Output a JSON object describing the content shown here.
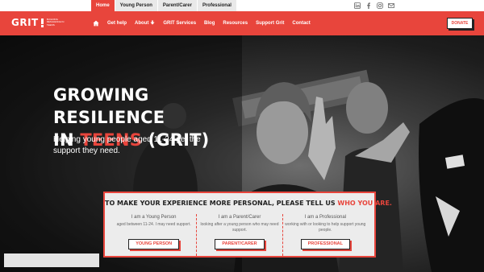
{
  "topbar": {
    "tabs": [
      "Home",
      "Young Person",
      "Parent/Carer",
      "Professional"
    ],
    "active_tab": "Home",
    "social_icons": [
      "linkedin-icon",
      "facebook-icon",
      "instagram-icon",
      "email-icon"
    ]
  },
  "brand": {
    "logo_text": "GRIT",
    "tagline": "Building resilience in teens"
  },
  "nav": {
    "items": [
      "Get help",
      "About",
      "GRIT Services",
      "Blog",
      "Resources",
      "Support Grit",
      "Contact"
    ],
    "donate": "DONATE"
  },
  "hero": {
    "title_line1": "GROWING RESILIENCE",
    "title_in": "IN ",
    "title_accent": "TEENS",
    "title_end": " (GRIT)",
    "subtitle": "Helping young people aged 11-24 get the support they need."
  },
  "panel": {
    "heading": "TO MAKE YOUR EXPERIENCE MORE PERSONAL, PLEASE TELL US ",
    "heading_accent": "WHO YOU ARE.",
    "options": [
      {
        "title": "I am a Young Person",
        "desc": "aged between 11-24. I may need support.",
        "button": "YOUNG PERSON"
      },
      {
        "title": "I am a Parent/Carer",
        "desc": "looking after a young person who may need support.",
        "button": "PARENT/CARER"
      },
      {
        "title": "I am a Professional",
        "desc": "working with or looking to help support young people.",
        "button": "PROFESSIONAL"
      }
    ]
  },
  "colors": {
    "accent": "#e8453c",
    "dark": "#222222"
  }
}
